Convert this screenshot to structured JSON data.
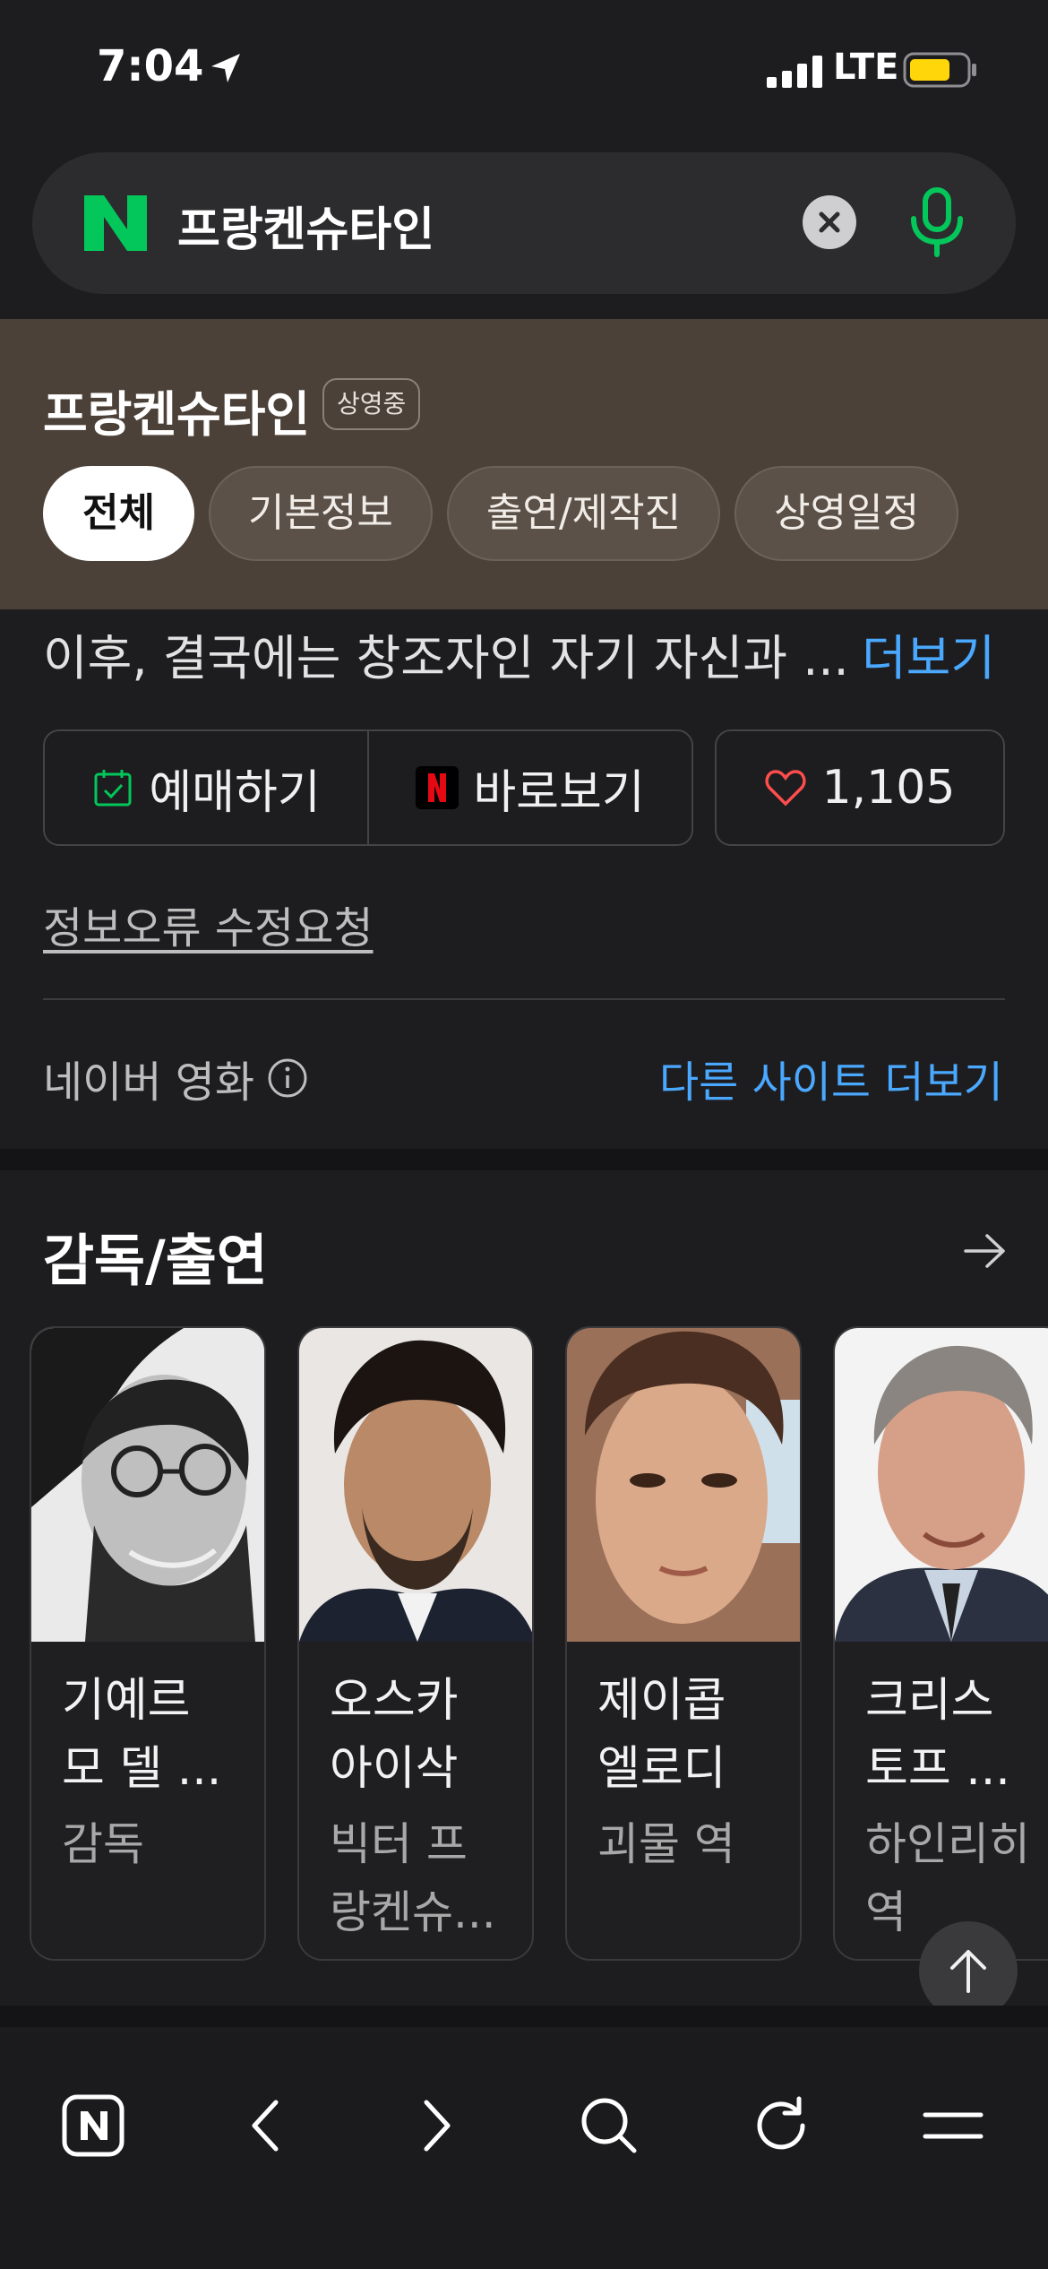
{
  "status_bar": {
    "time": "7:04",
    "network": "LTE"
  },
  "search": {
    "query": "프랑켄슈타인"
  },
  "movie": {
    "title": "프랑켄슈타인",
    "badge": "상영중",
    "tabs": [
      {
        "label": "전체",
        "active": true
      },
      {
        "label": "기본정보",
        "active": false
      },
      {
        "label": "출연/제작진",
        "active": false
      },
      {
        "label": "상영일정",
        "active": false
      }
    ],
    "synopsis": "이후, 결국에는 창조자인 자기 자신과 ...",
    "more_label": "더보기",
    "actions": {
      "reserve": "예매하기",
      "watch": "바로보기",
      "like_count": "1,105"
    },
    "report_label": "정보오류 수정요청",
    "source_label": "네이버 영화",
    "other_sites_label": "다른 사이트 더보기"
  },
  "cast": {
    "title": "감독/출연",
    "people": [
      {
        "name": "기예르\n모 델 ...",
        "role": "감독"
      },
      {
        "name": "오스카\n아이삭",
        "role": "빅터 프\n랑켄슈..."
      },
      {
        "name": "제이콥\n엘로디",
        "role": "괴물 역"
      },
      {
        "name": "크리스\n토프 ...",
        "role": "하인리히\n역"
      }
    ]
  },
  "colors": {
    "accent_green": "#03c75a",
    "link_blue": "#4aa8ff",
    "header_brown": "#4b4138",
    "battery_yellow": "#ffd60a",
    "like_red": "#ff4d4d"
  }
}
